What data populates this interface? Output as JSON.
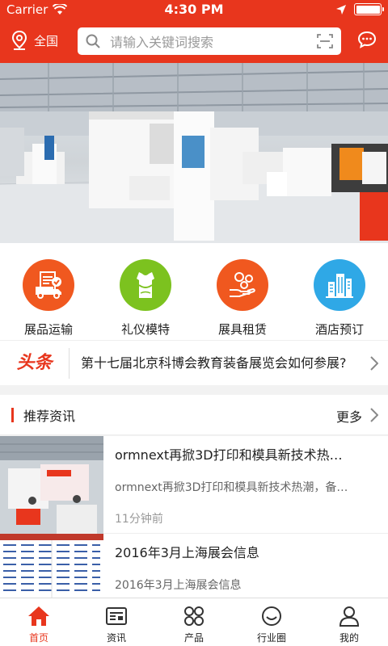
{
  "status": {
    "carrier": "Carrier",
    "time": "4:30 PM"
  },
  "header": {
    "location": "全国",
    "search_placeholder": "请输入关键词搜索"
  },
  "categories": [
    {
      "label": "展品运输",
      "color": "#f0581f",
      "icon": "truck-document-icon"
    },
    {
      "label": "礼仪模特",
      "color": "#7cc21f",
      "icon": "dress-icon"
    },
    {
      "label": "展具租赁",
      "color": "#f0581f",
      "icon": "hand-coins-icon"
    },
    {
      "label": "酒店预订",
      "color": "#2fa8e6",
      "icon": "hotel-building-icon"
    }
  ],
  "headline": {
    "logo": "头条",
    "text": "第十七届北京科博会教育装备展览会如何参展?"
  },
  "section": {
    "title": "推荐资讯",
    "more": "更多"
  },
  "news": [
    {
      "title": "ormnext再掀3D打印和模具新技术热…",
      "desc": "ormnext再掀3D打印和模具新技术热潮，备…",
      "time": "11分钟前"
    },
    {
      "title": "2016年3月上海展会信息",
      "desc": "2016年3月上海展会信息",
      "time": ""
    }
  ],
  "tabs": [
    {
      "label": "首页",
      "active": true
    },
    {
      "label": "资讯"
    },
    {
      "label": "产品"
    },
    {
      "label": "行业圈"
    },
    {
      "label": "我的"
    }
  ]
}
